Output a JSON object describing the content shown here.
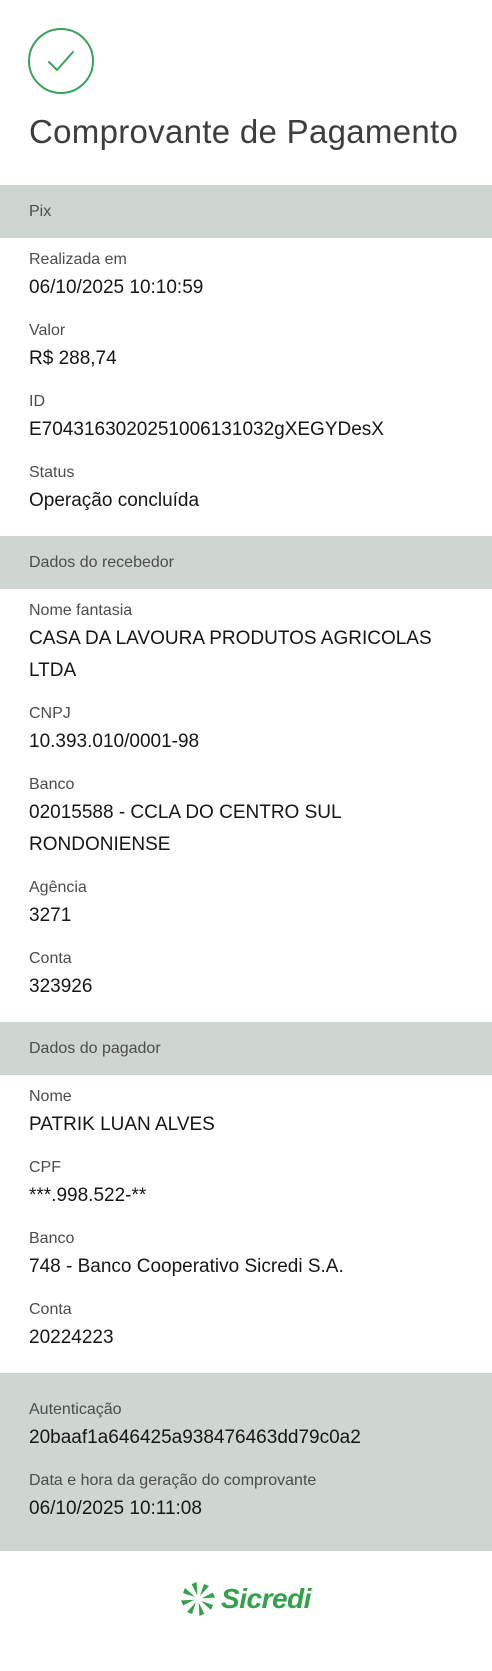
{
  "title": "Comprovante de Pagamento",
  "pix_section": {
    "header": "Pix",
    "fields": [
      {
        "label": "Realizada em",
        "value": "06/10/2025 10:10:59"
      },
      {
        "label": "Valor",
        "value": "R$ 288,74"
      },
      {
        "label": "ID",
        "value": "E70431630202510061310 32gXEGYDesX"
      },
      {
        "label": "Status",
        "value": "Operação concluída"
      }
    ]
  },
  "recebedor_section": {
    "header": "Dados do recebedor",
    "fields": [
      {
        "label": "Nome fantasia",
        "value": "CASA DA LAVOURA PRODUTOS AGRICOLAS LTDA"
      },
      {
        "label": "CNPJ",
        "value": "10.393.010/0001-98"
      },
      {
        "label": "Banco",
        "value": "02015588 - CCLA DO CENTRO SUL RONDONIENSE"
      },
      {
        "label": "Agência",
        "value": "3271"
      },
      {
        "label": "Conta",
        "value": "323926"
      }
    ]
  },
  "pagador_section": {
    "header": "Dados do pagador",
    "fields": [
      {
        "label": "Nome",
        "value": "PATRIK LUAN ALVES"
      },
      {
        "label": "CPF",
        "value": "***.998.522-**"
      },
      {
        "label": "Banco",
        "value": "748 - Banco Cooperativo Sicredi S.A."
      },
      {
        "label": "Conta",
        "value": "20224223"
      }
    ]
  },
  "footer": {
    "auth_label": "Autenticação",
    "auth_value": "20baaf1a646425a938476463dd79c0a2",
    "generated_label": "Data e hora da geração do comprovante",
    "generated_value": "06/10/2025 10:11:08"
  },
  "logo": {
    "text": "Sicredi",
    "icon": "sicredi-logo-icon"
  },
  "colors": {
    "accent": "#33a04b",
    "section_bg": "#cfd6d1"
  }
}
